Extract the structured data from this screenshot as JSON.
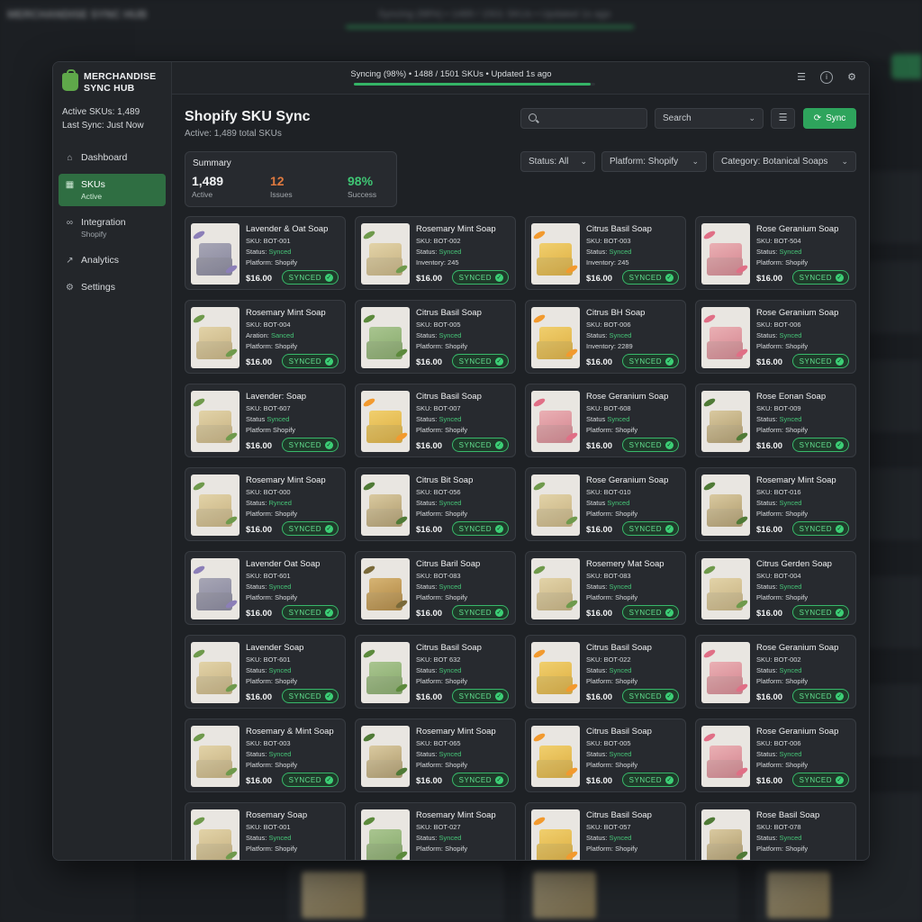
{
  "app": {
    "name": "MERCHANDISE SYNC HUB",
    "active_skus": "Active SKUs: 1,489",
    "last_sync": "Last Sync: Just Now"
  },
  "background": {
    "brand": "MERCHANDISE SYNC HUB",
    "sync_text": "Syncing (98%) • 1489 / 1501 SKUs • Updated 1s ago"
  },
  "nav": [
    {
      "label": "Dashboard",
      "sub": "",
      "icon": "home-icon"
    },
    {
      "label": "SKUs",
      "sub": "Active",
      "icon": "table-icon"
    },
    {
      "label": "Integration",
      "sub": "Shopify",
      "icon": "link-icon"
    },
    {
      "label": "Analytics",
      "sub": "",
      "icon": "chart-icon"
    },
    {
      "label": "Settings",
      "sub": "",
      "icon": "gear-icon"
    }
  ],
  "topbar": {
    "sync_status": "Syncing (98%) • 1488 / 1501 SKUs • Updated 1s ago",
    "progress": 0.98,
    "icons": [
      "sliders-icon",
      "info-icon",
      "gear-icon"
    ]
  },
  "page": {
    "title": "Shopify SKU Sync",
    "subtitle": "Active: 1,489 total SKUs"
  },
  "toolbar": {
    "search_placeholder": "",
    "search_select": "Search",
    "sync_label": "Sync"
  },
  "summary": {
    "title": "Summary",
    "stats": [
      {
        "value": "1,489",
        "label": "Active",
        "color": "#f2f3f4"
      },
      {
        "value": "12",
        "label": "Issues",
        "color": "#e07a3f"
      },
      {
        "value": "98%",
        "label": "Success",
        "color": "#3fc674"
      }
    ]
  },
  "filters": {
    "status": "Status: All",
    "platform": "Platform: Shopify",
    "category": "Category: Botanical Soaps"
  },
  "colors": {
    "accent": "#2ea45c",
    "synced": "#46c577",
    "issues": "#e07a3f"
  },
  "products": [
    {
      "name": "Lavender & Oat Soap",
      "l1": "SKU: BOT-001",
      "l2k": "Status: ",
      "l2v": "Synced",
      "l3": "Platform: Shopify",
      "price": "$16.00",
      "badge": "SYNCED",
      "soap": "lavender"
    },
    {
      "name": "Rosemary Mint Soap",
      "l1": "SKU: BOT-002",
      "l2k": "Status: ",
      "l2v": "Synced",
      "l3": "Inventory: 245",
      "price": "$16.00",
      "badge": "SYNCED",
      "soap": "cream"
    },
    {
      "name": "Citrus Basil Soap",
      "l1": "SKU: BOT-003",
      "l2k": "Status: ",
      "l2v": "Synced",
      "l3": "Inventory: 245",
      "price": "$16.00",
      "badge": "SYNCED",
      "soap": "yellow"
    },
    {
      "name": "Rose Geranium Soap",
      "l1": "SKU: BOT-504",
      "l2k": "Status: ",
      "l2v": "Synced",
      "l3": "Platform: Shopify",
      "price": "$16.00",
      "badge": "SYNCED",
      "soap": "pink"
    },
    {
      "name": "Rosemary Mint Soap",
      "l1": "SKU: BOT-004",
      "l2k": "Aration: ",
      "l2v": "Sanced",
      "l3": "Platform: Shopify",
      "price": "$16.00",
      "badge": "SYNCED",
      "soap": "cream"
    },
    {
      "name": "Citrus Basil Soap",
      "l1": "SKU: BOT-005",
      "l2k": "Status: ",
      "l2v": "Synced",
      "l3": "Platform: Shopify",
      "price": "$16.00",
      "badge": "SYNCED",
      "soap": "green"
    },
    {
      "name": "Citrus BH Soap",
      "l1": "SKU: BOT-006",
      "l2k": "Status: ",
      "l2v": "Synced",
      "l3": "Inventory: 2289",
      "price": "$16.00",
      "badge": "SYNCED",
      "soap": "yellow"
    },
    {
      "name": "Rose Geranium Soap",
      "l1": "SKU: BOT-006",
      "l2k": "Status: ",
      "l2v": "Synced",
      "l3": "Platform: Shopify",
      "price": "$16.00",
      "badge": "SYNCED",
      "soap": "pink"
    },
    {
      "name": "Lavender: Soap",
      "l1": "SKU: BOT-607",
      "l2k": "Status ",
      "l2v": "Synced",
      "l3": "Platform Shopify",
      "price": "$16.00",
      "badge": "SYNCED",
      "soap": "cream"
    },
    {
      "name": "Citrus Basil Soap",
      "l1": "SKU: BOT-007",
      "l2k": "Status: ",
      "l2v": "Synced",
      "l3": "Platform: Shopify",
      "price": "$16.00",
      "badge": "SYNCED",
      "soap": "yellow"
    },
    {
      "name": "Rose Geranium Soap",
      "l1": "SKU: BOT-608",
      "l2k": "Status ",
      "l2v": "Synced",
      "l3": "Platform: Shopify",
      "price": "$16.00",
      "badge": "SYNCED",
      "soap": "pink"
    },
    {
      "name": "Rose Eonan Soap",
      "l1": "SKU: BOT-009",
      "l2k": "Status: ",
      "l2v": "Synced",
      "l3": "Platform: Shopify",
      "price": "$16.00",
      "badge": "SYNCED",
      "soap": "herbal"
    },
    {
      "name": "Rosemary Mint Soap",
      "l1": "SKU: BOT-000",
      "l2k": "Status: ",
      "l2v": "Rynced",
      "l3": "Platform: Shopify",
      "price": "$16.00",
      "badge": "SYNCED",
      "soap": "cream"
    },
    {
      "name": "Citrus Bit Soap",
      "l1": "SKU: BOT-056",
      "l2k": "Status: ",
      "l2v": "Synced",
      "l3": "Platform: Shopify",
      "price": "$16.00",
      "badge": "SYNCED",
      "soap": "herbal"
    },
    {
      "name": "Rose Geranium Soap",
      "l1": "SKU: BOT-010",
      "l2k": "Status ",
      "l2v": "Synced",
      "l3": "Platform: Shopify",
      "price": "$16.00",
      "badge": "SYNCED",
      "soap": "cream"
    },
    {
      "name": "Rosemary Mint Soap",
      "l1": "SKU: BOT-016",
      "l2k": "Status: ",
      "l2v": "Synced",
      "l3": "Platform: Shopify",
      "price": "$16.00",
      "badge": "SYNCED",
      "soap": "herbal"
    },
    {
      "name": "Lavender Oat Soap",
      "l1": "SKU: BOT-601",
      "l2k": "Status: ",
      "l2v": "Synced",
      "l3": "Platform: Shopify",
      "price": "$16.00",
      "badge": "SYNCED",
      "soap": "lavender"
    },
    {
      "name": "Citrus Baril Soap",
      "l1": "SKU: BOT-083",
      "l2k": "Status: ",
      "l2v": "Synced",
      "l3": "Platform: Shopify",
      "price": "$16.00",
      "badge": "SYNCED",
      "soap": "brown"
    },
    {
      "name": "Rosemery Mat Soap",
      "l1": "SKU: BOT-083",
      "l2k": "Status: ",
      "l2v": "Synced",
      "l3": "Platform: Shopify",
      "price": "$16.00",
      "badge": "SYNCED",
      "soap": "cream"
    },
    {
      "name": "Citrus Gerden Soap",
      "l1": "SKU: BOT-004",
      "l2k": "Status: ",
      "l2v": "Synced",
      "l3": "Platform: Shopify",
      "price": "$16.00",
      "badge": "SYNCED",
      "soap": "cream"
    },
    {
      "name": "Lavender Soap",
      "l1": "SKU: BOT-601",
      "l2k": "Status: ",
      "l2v": "Synced",
      "l3": "Platform: Shopify",
      "price": "$16.00",
      "badge": "SYNCED",
      "soap": "cream"
    },
    {
      "name": "Citrus Basil Soap",
      "l1": "SKU: BOT 632",
      "l2k": "Status: ",
      "l2v": "Synced",
      "l3": "Platform: Shopify",
      "price": "$16.00",
      "badge": "SYNCED",
      "soap": "green"
    },
    {
      "name": "Citrus Basil Soap",
      "l1": "SKU: BOT-022",
      "l2k": "Status: ",
      "l2v": "Synced",
      "l3": "Platform: Shopify",
      "price": "$16.00",
      "badge": "SYNCED",
      "soap": "yellow"
    },
    {
      "name": "Rose Geranium Soap",
      "l1": "SKU: BOT-002",
      "l2k": "Status: ",
      "l2v": "Synced",
      "l3": "Platform: Shopify",
      "price": "$16.00",
      "badge": "SYNCED",
      "soap": "pink"
    },
    {
      "name": "Rosemary & Mint Soap",
      "l1": "SKU: BOT-003",
      "l2k": "Status: ",
      "l2v": "Synced",
      "l3": "Platform: Shopify",
      "price": "$16.00",
      "badge": "SYNCED",
      "soap": "cream"
    },
    {
      "name": "Rosemary Mint Soap",
      "l1": "SKU: BOT-065",
      "l2k": "Status: ",
      "l2v": "Synced",
      "l3": "Platform: Shopify",
      "price": "$16.00",
      "badge": "SYNCED",
      "soap": "herbal"
    },
    {
      "name": "Citrus Basil Soap",
      "l1": "SKU: BOT-005",
      "l2k": "Status: ",
      "l2v": "Synced",
      "l3": "Platform: Shopify",
      "price": "$16.00",
      "badge": "SYNCED",
      "soap": "yellow"
    },
    {
      "name": "Rose Geranium Soap",
      "l1": "SKU: BOT-006",
      "l2k": "Status: ",
      "l2v": "Synced",
      "l3": "Platform: Shopify",
      "price": "$16.00",
      "badge": "SYNCED",
      "soap": "pink"
    },
    {
      "name": "Rosemary Soap",
      "l1": "SKU: BOT-001",
      "l2k": "Status: ",
      "l2v": "Synced",
      "l3": "Platform: Shopify",
      "price": "",
      "badge": "",
      "soap": "cream"
    },
    {
      "name": "Rosemary Mint Soap",
      "l1": "SKU: BOT-027",
      "l2k": "Status: ",
      "l2v": "Synced",
      "l3": "Platform: Shopify",
      "price": "",
      "badge": "",
      "soap": "green"
    },
    {
      "name": "Citrus Basil Soap",
      "l1": "SKU: BOT-057",
      "l2k": "Status: ",
      "l2v": "Synced",
      "l3": "Platform: Shopify",
      "price": "",
      "badge": "",
      "soap": "yellow"
    },
    {
      "name": "Rose Basil Soap",
      "l1": "SKU: BOT-078",
      "l2k": "Status: ",
      "l2v": "Synced",
      "l3": "Platform: Shopify",
      "price": "",
      "badge": "",
      "soap": "herbal"
    }
  ]
}
